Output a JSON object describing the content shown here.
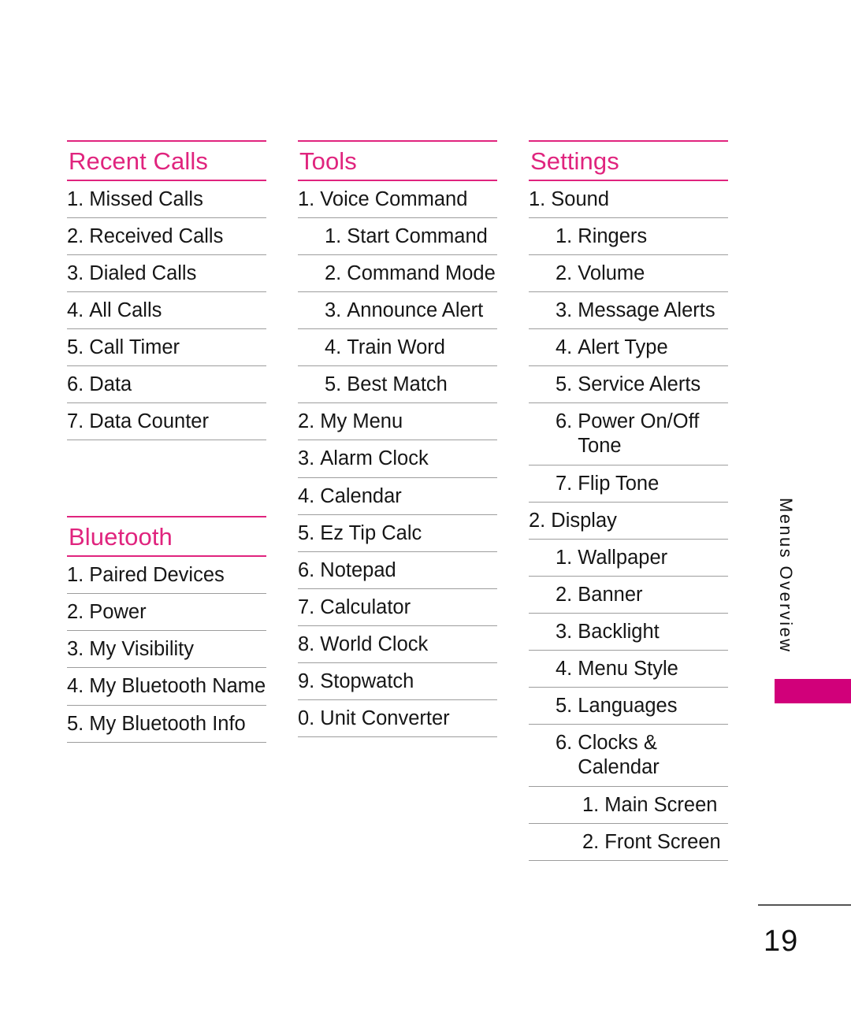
{
  "document": {
    "page_number": "19",
    "side_tab_label": "Menus Overview",
    "accent_color": "#e0247e",
    "tab_color": "#d1007a",
    "rule_color": "#9d9d9d"
  },
  "columns": [
    {
      "id": "column-1",
      "sections": [
        {
          "id": "recent-calls",
          "title": "Recent Calls",
          "items": [
            {
              "num": "1.",
              "label": "Missed Calls",
              "level": 1
            },
            {
              "num": "2.",
              "label": "Received Calls",
              "level": 1
            },
            {
              "num": "3.",
              "label": "Dialed Calls",
              "level": 1
            },
            {
              "num": "4.",
              "label": "All Calls",
              "level": 1
            },
            {
              "num": "5.",
              "label": "Call Timer",
              "level": 1
            },
            {
              "num": "6.",
              "label": "Data",
              "level": 1
            },
            {
              "num": "7.",
              "label": "Data Counter",
              "level": 1
            }
          ]
        },
        {
          "id": "bluetooth",
          "title": "Bluetooth",
          "spaced": true,
          "items": [
            {
              "num": "1.",
              "label": "Paired Devices",
              "level": 1
            },
            {
              "num": "2.",
              "label": "Power",
              "level": 1
            },
            {
              "num": "3.",
              "label": "My Visibility",
              "level": 1
            },
            {
              "num": "4.",
              "label": "My Bluetooth Name",
              "level": 1
            },
            {
              "num": "5.",
              "label": "My Bluetooth Info",
              "level": 1
            }
          ]
        }
      ]
    },
    {
      "id": "column-2",
      "sections": [
        {
          "id": "tools",
          "title": "Tools",
          "items": [
            {
              "num": "1.",
              "label": "Voice Command",
              "level": 1
            },
            {
              "num": "1.",
              "label": "Start Command",
              "level": 2
            },
            {
              "num": "2.",
              "label": "Command Mode",
              "level": 2
            },
            {
              "num": "3.",
              "label": "Announce Alert",
              "level": 2
            },
            {
              "num": "4.",
              "label": "Train Word",
              "level": 2
            },
            {
              "num": "5.",
              "label": "Best Match",
              "level": 2
            },
            {
              "num": "2.",
              "label": "My Menu",
              "level": 1
            },
            {
              "num": "3.",
              "label": "Alarm Clock",
              "level": 1
            },
            {
              "num": "4.",
              "label": "Calendar",
              "level": 1
            },
            {
              "num": "5.",
              "label": "Ez Tip Calc",
              "level": 1
            },
            {
              "num": "6.",
              "label": "Notepad",
              "level": 1
            },
            {
              "num": "7.",
              "label": "Calculator",
              "level": 1
            },
            {
              "num": "8.",
              "label": "World Clock",
              "level": 1
            },
            {
              "num": "9.",
              "label": "Stopwatch",
              "level": 1
            },
            {
              "num": "0.",
              "label": "Unit Converter",
              "level": 1
            }
          ]
        }
      ]
    },
    {
      "id": "column-3",
      "sections": [
        {
          "id": "settings",
          "title": "Settings",
          "items": [
            {
              "num": "1.",
              "label": "Sound",
              "level": 1
            },
            {
              "num": "1.",
              "label": "Ringers",
              "level": 2
            },
            {
              "num": "2.",
              "label": "Volume",
              "level": 2
            },
            {
              "num": "3.",
              "label": "Message Alerts",
              "level": 2
            },
            {
              "num": "4.",
              "label": "Alert Type",
              "level": 2
            },
            {
              "num": "5.",
              "label": "Service Alerts",
              "level": 2
            },
            {
              "num": "6.",
              "label": "Power On/Off Tone",
              "level": 2
            },
            {
              "num": "7.",
              "label": "Flip Tone",
              "level": 2
            },
            {
              "num": "2.",
              "label": "Display",
              "level": 1
            },
            {
              "num": "1.",
              "label": "Wallpaper",
              "level": 2
            },
            {
              "num": "2.",
              "label": "Banner",
              "level": 2
            },
            {
              "num": "3.",
              "label": "Backlight",
              "level": 2
            },
            {
              "num": "4.",
              "label": "Menu Style",
              "level": 2
            },
            {
              "num": "5.",
              "label": "Languages",
              "level": 2
            },
            {
              "num": "6.",
              "label": "Clocks & Calendar",
              "level": 2
            },
            {
              "num": "1.",
              "label": "Main Screen",
              "level": 3
            },
            {
              "num": "2.",
              "label": "Front Screen",
              "level": 3
            }
          ]
        }
      ]
    }
  ]
}
